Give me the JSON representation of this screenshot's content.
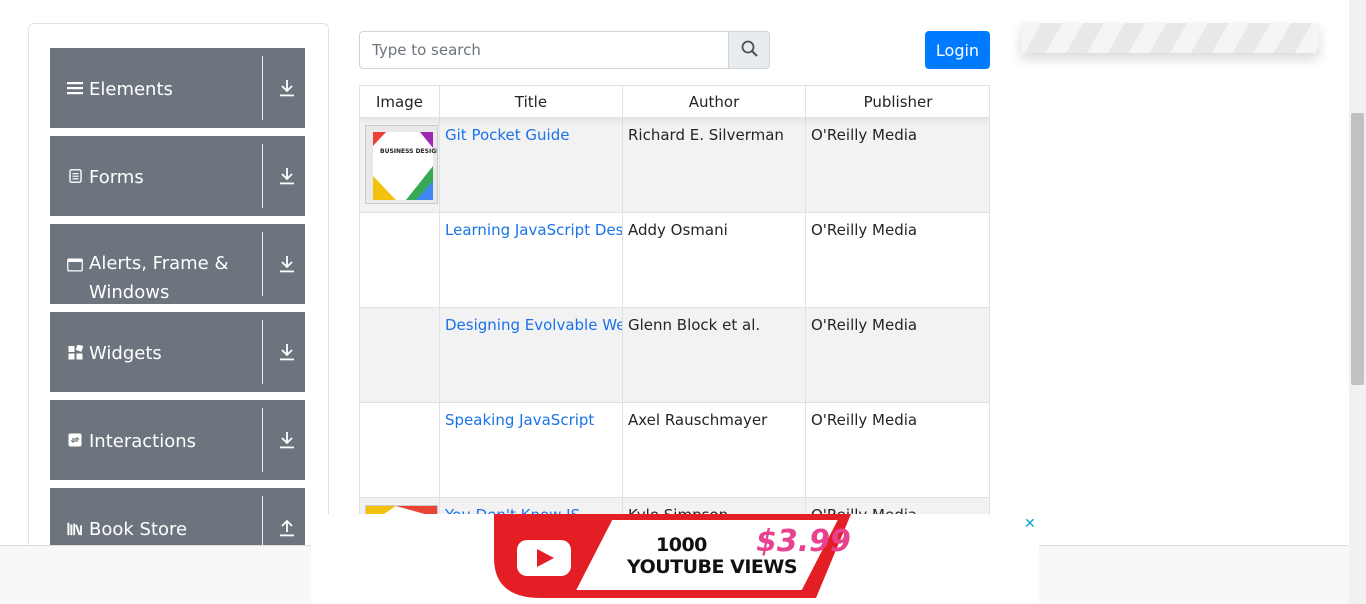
{
  "sidebar": {
    "groups": [
      {
        "label": "Elements",
        "icon": "menu-icon",
        "arrow": "download-arrow-icon"
      },
      {
        "label": "Forms",
        "icon": "form-icon",
        "arrow": "download-arrow-icon"
      },
      {
        "label": "Alerts, Frame & Windows",
        "icon": "window-icon",
        "arrow": "download-arrow-icon"
      },
      {
        "label": "Widgets",
        "icon": "widgets-icon",
        "arrow": "download-arrow-icon"
      },
      {
        "label": "Interactions",
        "icon": "interactions-icon",
        "arrow": "download-arrow-icon"
      },
      {
        "label": "Book Store",
        "icon": "books-icon",
        "arrow": "upload-arrow-icon"
      }
    ]
  },
  "search": {
    "placeholder": "Type to search",
    "value": ""
  },
  "login": {
    "label": "Login"
  },
  "table": {
    "headers": [
      "Image",
      "Title",
      "Author",
      "Publisher"
    ],
    "rows": [
      {
        "title": "Git Pocket Guide",
        "author": "Richard E. Silverman",
        "publisher": "O'Reilly Media",
        "has_image": true
      },
      {
        "title": "Learning JavaScript Design Patterns",
        "author": "Addy Osmani",
        "publisher": "O'Reilly Media",
        "has_image": false
      },
      {
        "title": "Designing Evolvable Web APIs with ASP.NET",
        "author": "Glenn Block et al.",
        "publisher": "O'Reilly Media",
        "has_image": false
      },
      {
        "title": "Speaking JavaScript",
        "author": "Axel Rauschmayer",
        "publisher": "O'Reilly Media",
        "has_image": false
      },
      {
        "title": "You Don't Know JS",
        "author": "Kyle Simpson",
        "publisher": "O'Reilly Media",
        "has_image": true
      }
    ],
    "thumbnail_text": "BUSINESS DESIGN"
  },
  "ad": {
    "line1": "1000",
    "line2": "YOUTUBE VIEWS",
    "price": "$3.99",
    "close": "✕"
  },
  "colors": {
    "sidebar_bg": "#6c757d",
    "link": "#1a73e8",
    "login_bg": "#007bff",
    "ad_red": "#e31e24",
    "ad_pink": "#e8428f"
  }
}
